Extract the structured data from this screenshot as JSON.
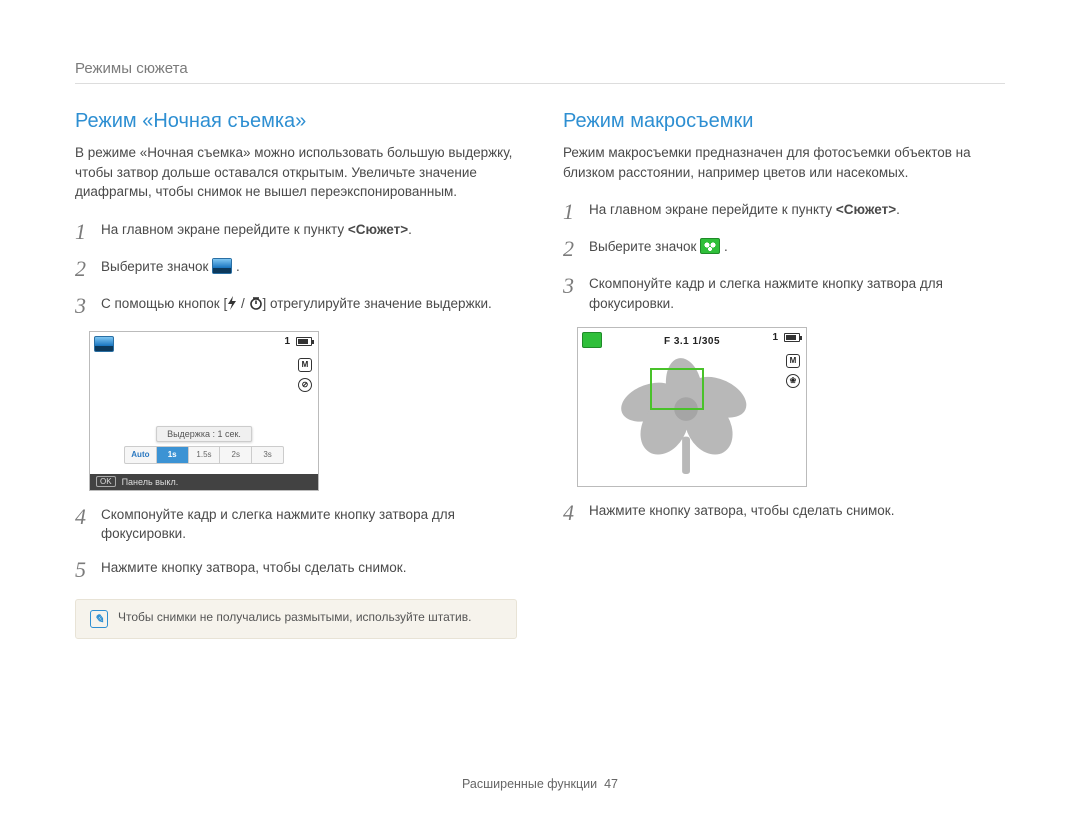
{
  "breadcrumb": "Режимы сюжета",
  "left": {
    "title": "Режим «Ночная съемка»",
    "intro": "В режиме «Ночная съемка» можно использовать большую выдержку, чтобы затвор дольше оставался открытым. Увеличьте значение диафрагмы, чтобы снимок не вышел переэкспонированным.",
    "steps": {
      "s1_a": "На главном экране перейдите к пункту ",
      "s1_b": "<Сюжет>",
      "s1_c": ".",
      "s2": "Выберите значок ",
      "s3_a": "С помощью кнопок [",
      "s3_b": " / ",
      "s3_c": "] отрегулируйте значение выдержки.",
      "s4": "Скомпонуйте кадр и слегка нажмите кнопку затвора для фокусировки.",
      "s5": "Нажмите кнопку затвора, чтобы сделать снимок."
    },
    "cam": {
      "counter": "1",
      "mode_m": "M",
      "flash": "⊘",
      "mid_label": "Выдержка : 1 сек.",
      "slider": [
        "Auto",
        "1s",
        "1.5s",
        "2s",
        "3s"
      ],
      "ok": "OK",
      "bottom": "Панель выкл."
    },
    "note": "Чтобы снимки не получались размытыми, используйте штатив."
  },
  "right": {
    "title": "Режим макросъемки",
    "intro": "Режим макросъемки предназначен для фотосъемки объектов на близком расстоянии, например цветов или насекомых.",
    "steps": {
      "s1_a": "На главном экране перейдите к пункту ",
      "s1_b": "<Сюжет>",
      "s1_c": ".",
      "s2": "Выберите значок ",
      "s3": "Скомпонуйте кадр и слегка нажмите кнопку затвора для фокусировки.",
      "s4": "Нажмите кнопку затвора, чтобы сделать снимок."
    },
    "cam": {
      "counter": "1",
      "fstop": "F 3.1 1/305",
      "mode_m": "M",
      "macro": "❀"
    }
  },
  "footer": {
    "label": "Расширенные функции",
    "page": "47"
  },
  "nums": {
    "n1": "1",
    "n2": "2",
    "n3": "3",
    "n4": "4",
    "n5": "5"
  }
}
